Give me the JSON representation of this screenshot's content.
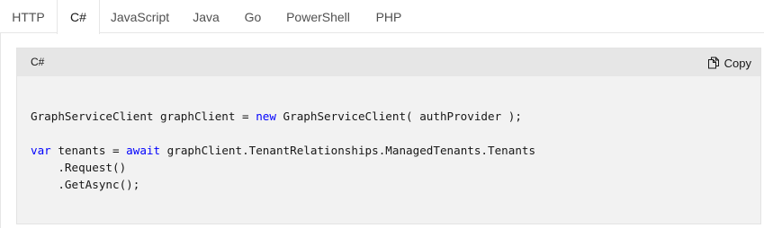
{
  "tabs": [
    {
      "label": "HTTP",
      "active": false
    },
    {
      "label": "C#",
      "active": true
    },
    {
      "label": "JavaScript",
      "active": false
    },
    {
      "label": "Java",
      "active": false
    },
    {
      "label": "Go",
      "active": false
    },
    {
      "label": "PowerShell",
      "active": false
    },
    {
      "label": "PHP",
      "active": false
    }
  ],
  "code_block": {
    "language_label": "C#",
    "copy_label": "Copy",
    "copy_icon": "copy-icon",
    "keyword_color": "#0101fd",
    "lines": [
      [
        {
          "t": "GraphServiceClient graphClient = "
        },
        {
          "t": "new",
          "kw": true
        },
        {
          "t": " GraphServiceClient( authProvider );"
        }
      ],
      [
        {
          "t": ""
        }
      ],
      [
        {
          "t": "var",
          "kw": true
        },
        {
          "t": " tenants = "
        },
        {
          "t": "await",
          "kw": true
        },
        {
          "t": " graphClient.TenantRelationships.ManagedTenants.Tenants"
        }
      ],
      [
        {
          "t": "    .Request()"
        }
      ],
      [
        {
          "t": "    .GetAsync();"
        }
      ]
    ]
  }
}
